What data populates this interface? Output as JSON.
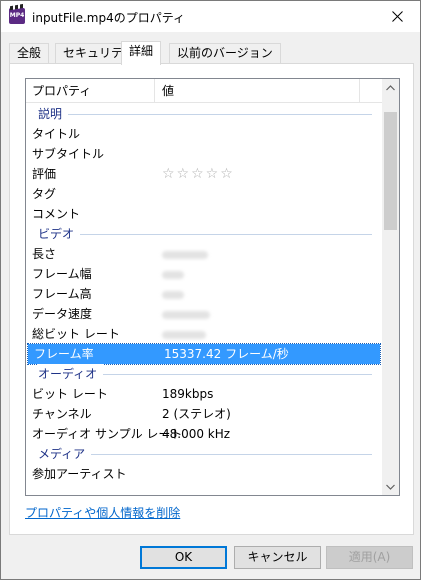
{
  "window": {
    "title": "inputFile.mp4のプロパティ",
    "icon_label": "MP4"
  },
  "tabs": [
    {
      "label": "全般"
    },
    {
      "label": "セキュリティ"
    },
    {
      "label": "詳細"
    },
    {
      "label": "以前のバージョン"
    }
  ],
  "list": {
    "header": {
      "property": "プロパティ",
      "value": "値"
    },
    "groups": {
      "description": "説明",
      "video": "ビデオ",
      "audio": "オーディオ",
      "media": "メディア"
    },
    "rows": {
      "title": {
        "k": "タイトル",
        "v": ""
      },
      "subtitle": {
        "k": "サブタイトル",
        "v": ""
      },
      "rating": {
        "k": "評価",
        "v": "☆☆☆☆☆"
      },
      "tags": {
        "k": "タグ",
        "v": ""
      },
      "comment": {
        "k": "コメント",
        "v": ""
      },
      "length": {
        "k": "長さ"
      },
      "frame_width": {
        "k": "フレーム幅"
      },
      "frame_height": {
        "k": "フレーム高"
      },
      "data_rate": {
        "k": "データ速度"
      },
      "total_bitrate": {
        "k": "総ビット レート"
      },
      "frame_rate": {
        "k": "フレーム率",
        "v": "15337.42 フレーム/秒"
      },
      "bitrate": {
        "k": "ビット レート",
        "v": "189kbps"
      },
      "channels": {
        "k": "チャンネル",
        "v": "2 (ステレオ)"
      },
      "sample_rate": {
        "k": "オーディオ サンプル レート",
        "v": "48.000 kHz"
      },
      "contributing_artists": {
        "k": "参加アーティスト"
      }
    }
  },
  "link_text": "プロパティや個人情報を削除",
  "buttons": {
    "ok": "OK",
    "cancel": "キャンセル",
    "apply": "適用(A)"
  },
  "colors": {
    "selection": "#3399ff",
    "link": "#0066cc",
    "group_header": "#1e3287",
    "ok_border": "#0078d7"
  }
}
